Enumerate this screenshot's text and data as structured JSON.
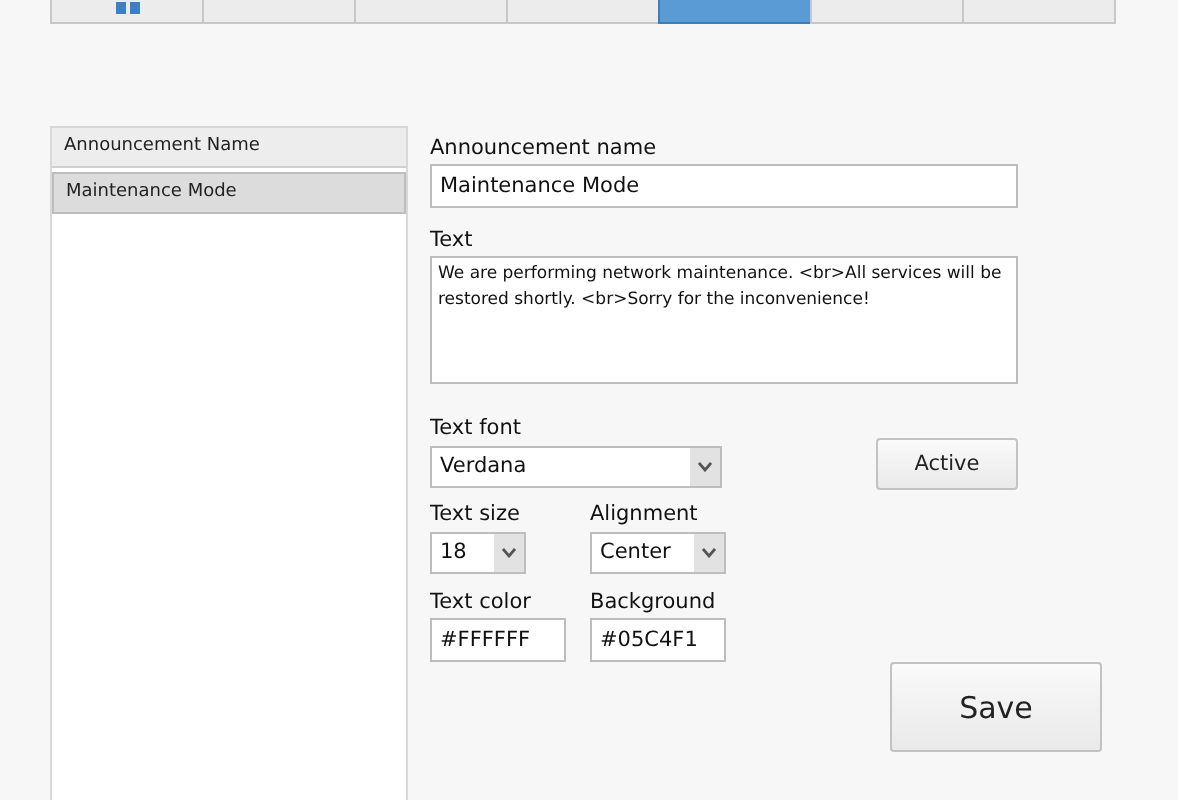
{
  "tabs": [
    {
      "kind": "icon",
      "selected": false
    },
    {
      "kind": "blank",
      "selected": false
    },
    {
      "kind": "blank",
      "selected": false
    },
    {
      "kind": "blank",
      "selected": false
    },
    {
      "kind": "blank",
      "selected": true
    },
    {
      "kind": "blank",
      "selected": false
    },
    {
      "kind": "blank",
      "selected": false
    }
  ],
  "announcement_list": {
    "header": "Announcement Name",
    "items": [
      {
        "label": "Maintenance Mode",
        "selected": true
      }
    ]
  },
  "form": {
    "name_label": "Announcement name",
    "name_value": "Maintenance Mode",
    "text_label": "Text",
    "text_value": "We are performing network maintenance. <br>All services will be restored shortly. <br>Sorry for the inconvenience!",
    "font_label": "Text font",
    "font_value": "Verdana",
    "active_button": "Active",
    "size_label": "Text size",
    "size_value": "18",
    "alignment_label": "Alignment",
    "alignment_value": "Center",
    "text_color_label": "Text color",
    "text_color_value": "#FFFFFF",
    "background_label": "Background",
    "background_value": "#05C4F1",
    "save_button": "Save"
  }
}
